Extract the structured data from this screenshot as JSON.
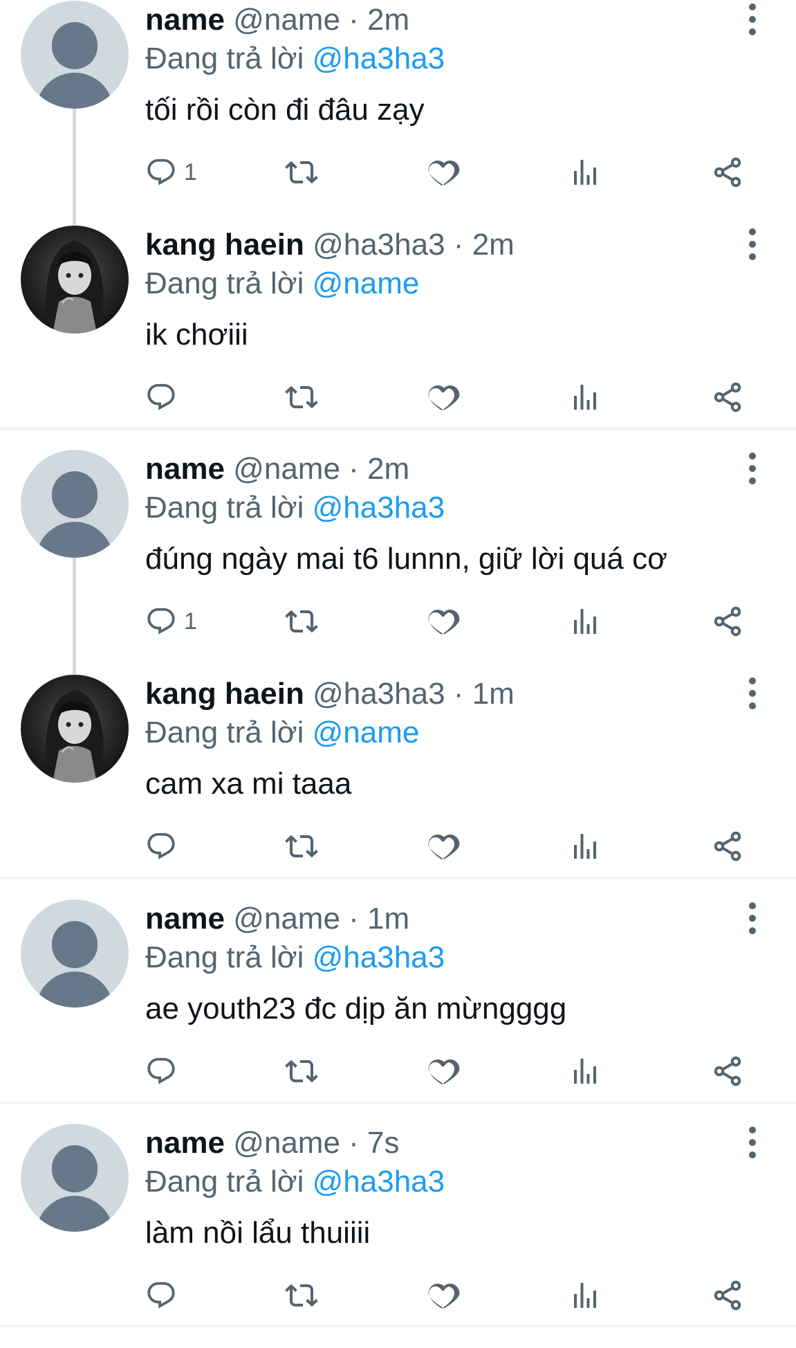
{
  "colors": {
    "accent": "#1d9bf0",
    "secondary_text": "#536471",
    "primary_text": "#0f1419",
    "divider": "#eff3f4"
  },
  "icons": {
    "reply": "reply-icon",
    "retweet": "retweet-icon",
    "like": "heart-icon",
    "views": "views-icon",
    "share": "share-icon",
    "more": "more-vertical-icon"
  },
  "tweets": [
    {
      "name": "name",
      "handle": "@name",
      "time": "2m",
      "reply_prefix": "Đang trả lời ",
      "reply_to": "@ha3ha3",
      "text": "tối rồi còn đi đâu zạy",
      "reply_count": "1",
      "avatar": "default-avatar"
    },
    {
      "name": "kang haein",
      "handle": "@ha3ha3",
      "time": "2m",
      "reply_prefix": "Đang trả lời ",
      "reply_to": "@name",
      "text": "ik chơiii",
      "reply_count": "",
      "avatar": "photo-avatar"
    },
    {
      "name": "name",
      "handle": "@name",
      "time": "2m",
      "reply_prefix": "Đang trả lời ",
      "reply_to": "@ha3ha3",
      "text": "đúng ngày mai t6 lunnn, giữ lời quá cơ",
      "reply_count": "1",
      "avatar": "default-avatar"
    },
    {
      "name": "kang haein",
      "handle": "@ha3ha3",
      "time": "1m",
      "reply_prefix": "Đang trả lời ",
      "reply_to": "@name",
      "text": "cam xa mi taaa",
      "reply_count": "",
      "avatar": "photo-avatar"
    },
    {
      "name": "name",
      "handle": "@name",
      "time": "1m",
      "reply_prefix": "Đang trả lời ",
      "reply_to": "@ha3ha3",
      "text": "ae youth23 đc dịp ăn mừngggg",
      "reply_count": "",
      "avatar": "default-avatar"
    },
    {
      "name": "name",
      "handle": "@name",
      "time": "7s",
      "reply_prefix": "Đang trả lời ",
      "reply_to": "@ha3ha3",
      "text": "làm nồi lẩu thuiiii",
      "reply_count": "",
      "avatar": "default-avatar"
    }
  ]
}
